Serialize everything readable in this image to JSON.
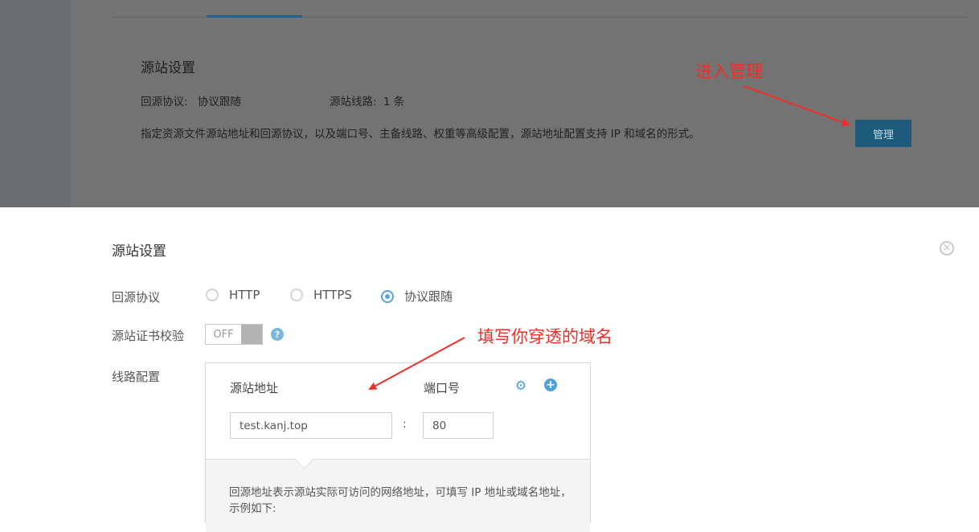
{
  "background_page": {
    "section_title": "源站设置",
    "protocol_label": "回源协议:",
    "protocol_value": "协议跟随",
    "lines_label": "源站线路:",
    "lines_value": "1 条",
    "description": "指定资源文件源站地址和回源协议，以及端口号、主备线路、权重等高级配置，源站地址配置支持 IP 和域名的形式。",
    "manage_button": "管理"
  },
  "annotations": {
    "enter_manage": "进入管理",
    "fill_domain": "填写你穿透的域名",
    "color": "#ef2f27"
  },
  "modal": {
    "title": "源站设置",
    "close_glyph": "×",
    "protocol": {
      "label": "回源协议",
      "options": [
        {
          "label": "HTTP",
          "checked": false
        },
        {
          "label": "HTTPS",
          "checked": false
        },
        {
          "label": "协议跟随",
          "checked": true
        }
      ]
    },
    "cert_check": {
      "label": "源站证书校验",
      "toggle_text": "OFF",
      "help_glyph": "?"
    },
    "route_config": {
      "label": "线路配置",
      "address_header": "源站地址",
      "port_header": "端口号",
      "address_value": "test.kanj.top",
      "port_value": "80",
      "colon": ":",
      "note": "回源地址表示源站实际可访问的网络地址，可填写 IP 地址或域名地址，示例如下:"
    }
  },
  "colors": {
    "accent": "#4da0d9",
    "manage_button_bg": "#1e5a7c",
    "overlay": "#737373"
  }
}
